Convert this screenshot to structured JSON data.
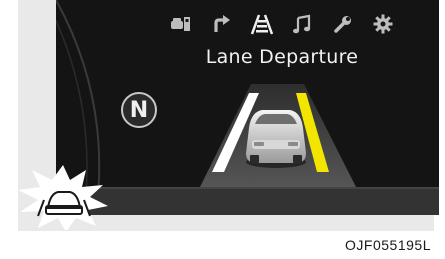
{
  "display": {
    "title": "Lane Departure",
    "gear_indicator": "N",
    "menu_icons": [
      {
        "name": "driving-assist-icon",
        "active": false
      },
      {
        "name": "navigation-turn-icon",
        "active": false
      },
      {
        "name": "lane-assist-icon",
        "active": true
      },
      {
        "name": "music-icon",
        "active": false
      },
      {
        "name": "service-wrench-icon",
        "active": false
      },
      {
        "name": "settings-gear-icon",
        "active": false
      }
    ],
    "warning_icon": "lane-warning-icon",
    "lane_colors": {
      "left": "#ffffff",
      "right": "#f2e600"
    }
  },
  "figure_label": "OJF055195L"
}
